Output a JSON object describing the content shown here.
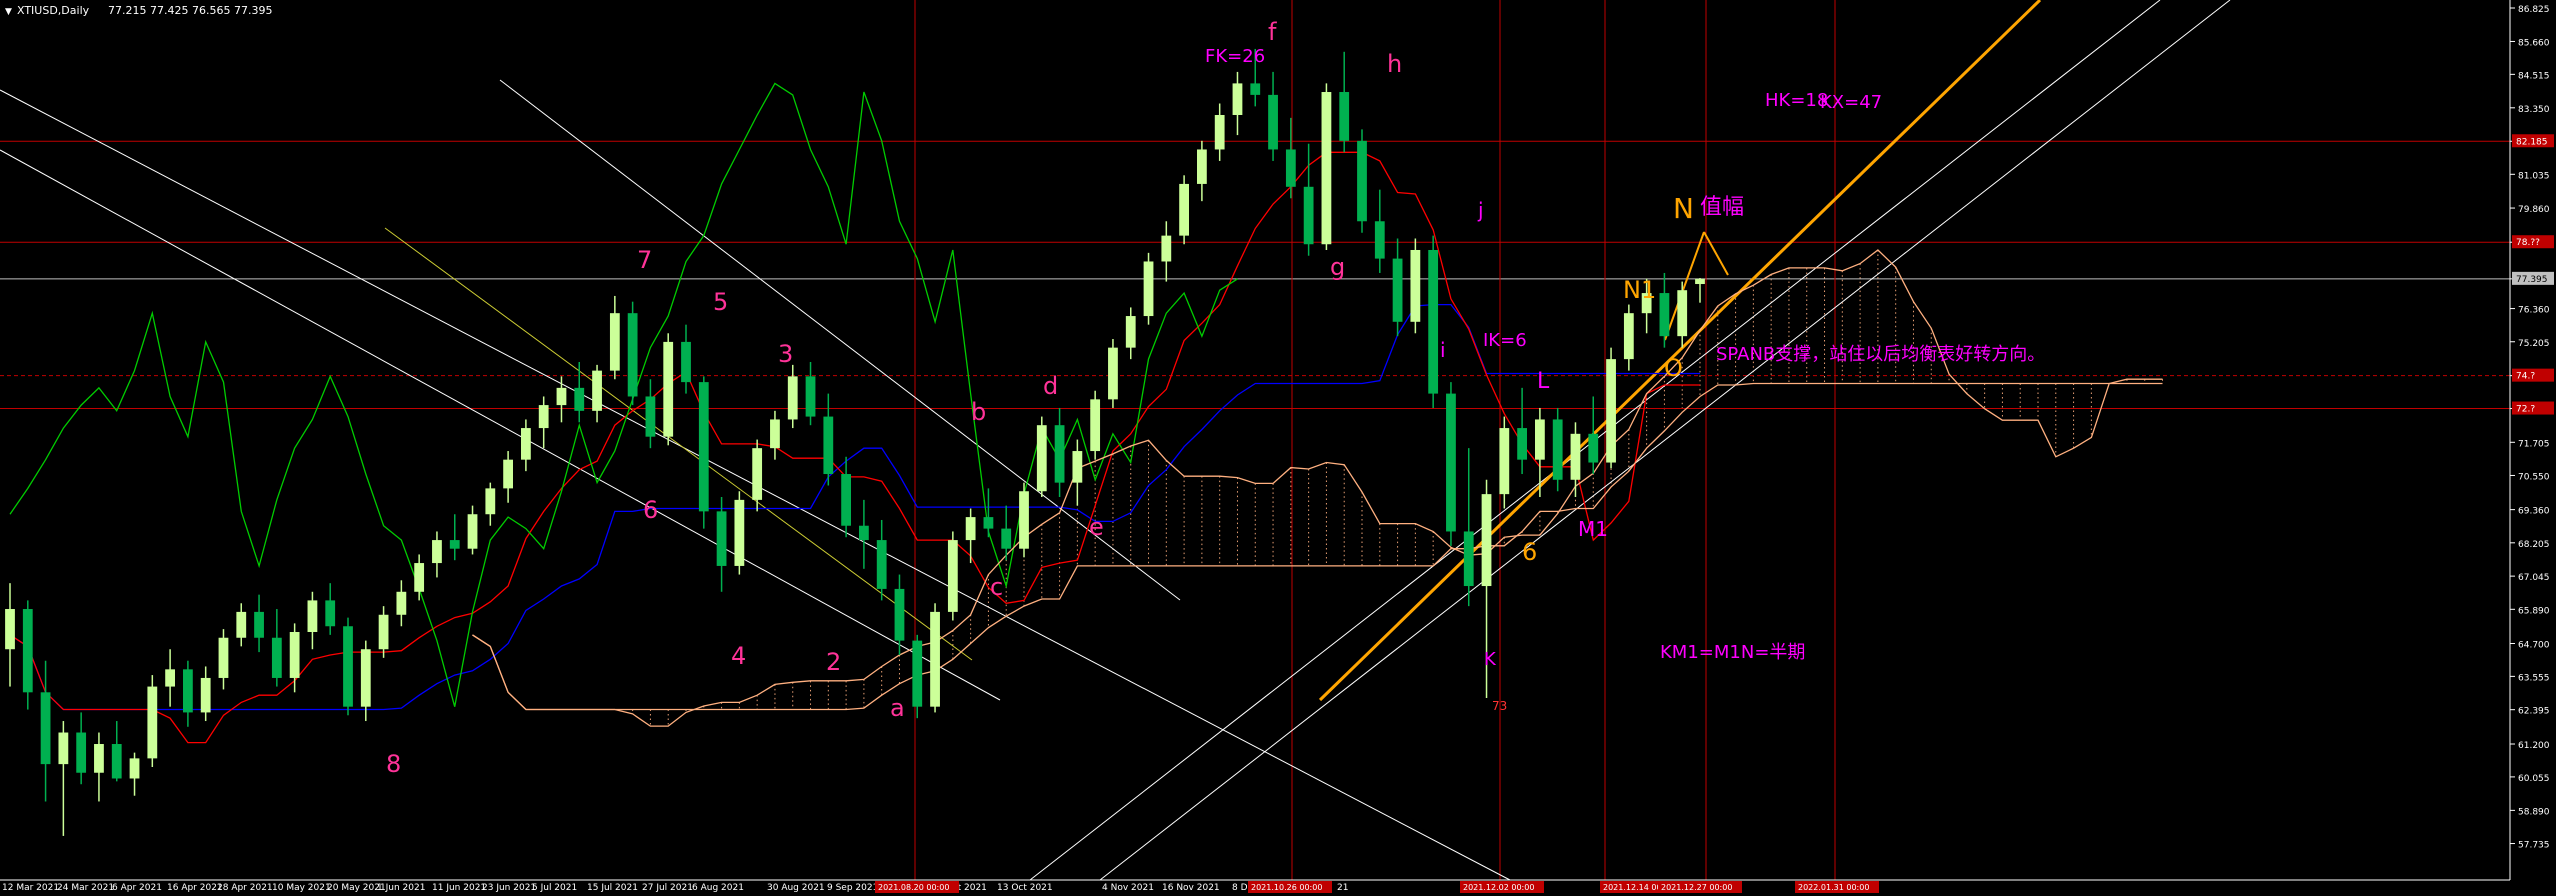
{
  "header": {
    "symbol": "XTIUSD,Daily",
    "ohlc": "77.215 77.425 76.565 77.395"
  },
  "colors": {
    "background": "#000000",
    "bull": "#ccff99",
    "bear": "#00b050",
    "tenkan": "#ff0000",
    "kijun": "#0000ff",
    "chikou": "#00cc00",
    "cloud": "#ffb080",
    "hline": "#c00000",
    "vline": "#c00000",
    "trend": "#ffffff",
    "channel": "#ffa500",
    "label_pink": "#ff3399",
    "label_magenta": "#ff00ff",
    "label_orange": "#ffa500",
    "axis_text": "#ffffff"
  },
  "y_ticks": [
    "86.825",
    "85.660",
    "84.515",
    "83.350",
    "82.185",
    "81.035",
    "79.860",
    "78.670",
    "77.395",
    "76.360",
    "75.205",
    "74.025",
    "72.880",
    "71.705",
    "70.550",
    "69.360",
    "68.205",
    "67.045",
    "65.890",
    "64.700",
    "63.555",
    "62.395",
    "61.200",
    "60.055",
    "58.890",
    "57.735",
    "56.570"
  ],
  "y_badges": {
    "h1": "82.185",
    "h2": "78.??",
    "h3": "74.?",
    "h4": "72.?",
    "last_price": "77.395"
  },
  "x_ticks": [
    "12 Mar 2021",
    "24 Mar 2021",
    "6 Apr 2021",
    "16 Apr 2021",
    "28 Apr 2021",
    "10 May 2021",
    "20 May 2021",
    "1 Jun 2021",
    "11 Jun 2021",
    "23 Jun 2021",
    "5 Jul 2021",
    "15 Jul 2021",
    "27 Jul 2021",
    "6 Aug 2021",
    "30 Aug 2021",
    "9 Sep 2021",
    "21 Sep 2021",
    "1 Oct 2021",
    "13 Oct 2021",
    "4 Nov 2021",
    "16 Nov 2021",
    "8 Dec 2021",
    "21"
  ],
  "x_badges": [
    "2021.08.20 00:00",
    "2021.10.26 00:00",
    "2021.12.02 00:00",
    "2021.12.14 00:00",
    "2021.12.27 00:00",
    "2022.01.31 00:00"
  ],
  "chart_data": {
    "type": "candlestick",
    "title": "XTIUSD,Daily",
    "ylim": [
      56.57,
      86.825
    ],
    "candles": [
      {
        "o": 64.5,
        "h": 66.8,
        "l": 63.2,
        "c": 65.9
      },
      {
        "o": 65.9,
        "h": 66.2,
        "l": 62.4,
        "c": 63.0
      },
      {
        "o": 63.0,
        "h": 64.1,
        "l": 59.2,
        "c": 60.5
      },
      {
        "o": 60.5,
        "h": 62.0,
        "l": 58.0,
        "c": 61.6
      },
      {
        "o": 61.6,
        "h": 62.3,
        "l": 59.8,
        "c": 60.2
      },
      {
        "o": 60.2,
        "h": 61.6,
        "l": 59.2,
        "c": 61.2
      },
      {
        "o": 61.2,
        "h": 62.0,
        "l": 59.9,
        "c": 60.0
      },
      {
        "o": 60.0,
        "h": 60.9,
        "l": 59.4,
        "c": 60.7
      },
      {
        "o": 60.7,
        "h": 63.6,
        "l": 60.4,
        "c": 63.2
      },
      {
        "o": 63.2,
        "h": 64.5,
        "l": 62.5,
        "c": 63.8
      },
      {
        "o": 63.8,
        "h": 64.1,
        "l": 61.8,
        "c": 62.3
      },
      {
        "o": 62.3,
        "h": 63.9,
        "l": 62.0,
        "c": 63.5
      },
      {
        "o": 63.5,
        "h": 65.2,
        "l": 63.1,
        "c": 64.9
      },
      {
        "o": 64.9,
        "h": 66.1,
        "l": 64.6,
        "c": 65.8
      },
      {
        "o": 65.8,
        "h": 66.4,
        "l": 64.4,
        "c": 64.9
      },
      {
        "o": 64.9,
        "h": 65.9,
        "l": 63.2,
        "c": 63.5
      },
      {
        "o": 63.5,
        "h": 65.4,
        "l": 63.0,
        "c": 65.1
      },
      {
        "o": 65.1,
        "h": 66.5,
        "l": 64.5,
        "c": 66.2
      },
      {
        "o": 66.2,
        "h": 66.8,
        "l": 65.0,
        "c": 65.3
      },
      {
        "o": 65.3,
        "h": 65.6,
        "l": 62.2,
        "c": 62.5
      },
      {
        "o": 62.5,
        "h": 64.8,
        "l": 62.0,
        "c": 64.5
      },
      {
        "o": 64.5,
        "h": 66.0,
        "l": 64.2,
        "c": 65.7
      },
      {
        "o": 65.7,
        "h": 66.9,
        "l": 65.3,
        "c": 66.5
      },
      {
        "o": 66.5,
        "h": 67.8,
        "l": 66.2,
        "c": 67.5
      },
      {
        "o": 67.5,
        "h": 68.6,
        "l": 67.0,
        "c": 68.3
      },
      {
        "o": 68.3,
        "h": 69.2,
        "l": 67.6,
        "c": 68.0
      },
      {
        "o": 68.0,
        "h": 69.5,
        "l": 67.8,
        "c": 69.2
      },
      {
        "o": 69.2,
        "h": 70.3,
        "l": 68.8,
        "c": 70.1
      },
      {
        "o": 70.1,
        "h": 71.4,
        "l": 69.6,
        "c": 71.1
      },
      {
        "o": 71.1,
        "h": 72.5,
        "l": 70.7,
        "c": 72.2
      },
      {
        "o": 72.2,
        "h": 73.3,
        "l": 71.5,
        "c": 73.0
      },
      {
        "o": 73.0,
        "h": 74.0,
        "l": 72.4,
        "c": 73.6
      },
      {
        "o": 73.6,
        "h": 74.5,
        "l": 72.4,
        "c": 72.8
      },
      {
        "o": 72.8,
        "h": 74.4,
        "l": 72.4,
        "c": 74.2
      },
      {
        "o": 74.2,
        "h": 76.8,
        "l": 73.9,
        "c": 76.2
      },
      {
        "o": 76.2,
        "h": 76.6,
        "l": 73.0,
        "c": 73.3
      },
      {
        "o": 73.3,
        "h": 73.9,
        "l": 71.5,
        "c": 71.9
      },
      {
        "o": 71.9,
        "h": 75.5,
        "l": 71.6,
        "c": 75.2
      },
      {
        "o": 75.2,
        "h": 75.8,
        "l": 73.4,
        "c": 73.8
      },
      {
        "o": 73.8,
        "h": 74.0,
        "l": 68.7,
        "c": 69.3
      },
      {
        "o": 69.3,
        "h": 69.8,
        "l": 66.5,
        "c": 67.4
      },
      {
        "o": 67.4,
        "h": 70.0,
        "l": 67.1,
        "c": 69.7
      },
      {
        "o": 69.7,
        "h": 71.8,
        "l": 69.3,
        "c": 71.5
      },
      {
        "o": 71.5,
        "h": 72.8,
        "l": 71.1,
        "c": 72.5
      },
      {
        "o": 72.5,
        "h": 74.4,
        "l": 72.2,
        "c": 74.0
      },
      {
        "o": 74.0,
        "h": 74.5,
        "l": 72.3,
        "c": 72.6
      },
      {
        "o": 72.6,
        "h": 73.4,
        "l": 70.2,
        "c": 70.6
      },
      {
        "o": 70.6,
        "h": 71.2,
        "l": 68.4,
        "c": 68.8
      },
      {
        "o": 68.8,
        "h": 69.7,
        "l": 67.3,
        "c": 68.3
      },
      {
        "o": 68.3,
        "h": 69.0,
        "l": 66.2,
        "c": 66.6
      },
      {
        "o": 66.6,
        "h": 67.1,
        "l": 64.3,
        "c": 64.8
      },
      {
        "o": 64.8,
        "h": 65.0,
        "l": 62.1,
        "c": 62.5
      },
      {
        "o": 62.5,
        "h": 66.1,
        "l": 62.3,
        "c": 65.8
      },
      {
        "o": 65.8,
        "h": 68.6,
        "l": 65.5,
        "c": 68.3
      },
      {
        "o": 68.3,
        "h": 69.4,
        "l": 67.5,
        "c": 69.1
      },
      {
        "o": 69.1,
        "h": 70.1,
        "l": 68.4,
        "c": 68.7
      },
      {
        "o": 68.7,
        "h": 69.5,
        "l": 67.6,
        "c": 68.0
      },
      {
        "o": 68.0,
        "h": 70.3,
        "l": 67.7,
        "c": 70.0
      },
      {
        "o": 70.0,
        "h": 72.6,
        "l": 69.8,
        "c": 72.3
      },
      {
        "o": 72.3,
        "h": 72.9,
        "l": 69.8,
        "c": 70.3
      },
      {
        "o": 70.3,
        "h": 71.8,
        "l": 69.5,
        "c": 71.4
      },
      {
        "o": 71.4,
        "h": 73.5,
        "l": 71.1,
        "c": 73.2
      },
      {
        "o": 73.2,
        "h": 75.3,
        "l": 72.9,
        "c": 75.0
      },
      {
        "o": 75.0,
        "h": 76.4,
        "l": 74.6,
        "c": 76.1
      },
      {
        "o": 76.1,
        "h": 78.3,
        "l": 75.8,
        "c": 78.0
      },
      {
        "o": 78.0,
        "h": 79.4,
        "l": 77.3,
        "c": 78.9
      },
      {
        "o": 78.9,
        "h": 81.0,
        "l": 78.6,
        "c": 80.7
      },
      {
        "o": 80.7,
        "h": 82.2,
        "l": 80.1,
        "c": 81.9
      },
      {
        "o": 81.9,
        "h": 83.5,
        "l": 81.5,
        "c": 83.1
      },
      {
        "o": 83.1,
        "h": 84.6,
        "l": 82.4,
        "c": 84.2
      },
      {
        "o": 84.2,
        "h": 85.4,
        "l": 83.4,
        "c": 83.8
      },
      {
        "o": 83.8,
        "h": 84.6,
        "l": 81.5,
        "c": 81.9
      },
      {
        "o": 81.9,
        "h": 83.0,
        "l": 80.2,
        "c": 80.6
      },
      {
        "o": 80.6,
        "h": 82.1,
        "l": 78.2,
        "c": 78.6
      },
      {
        "o": 78.6,
        "h": 84.2,
        "l": 78.4,
        "c": 83.9
      },
      {
        "o": 83.9,
        "h": 85.3,
        "l": 81.8,
        "c": 82.2
      },
      {
        "o": 82.2,
        "h": 82.6,
        "l": 79.0,
        "c": 79.4
      },
      {
        "o": 79.4,
        "h": 80.5,
        "l": 77.6,
        "c": 78.1
      },
      {
        "o": 78.1,
        "h": 78.8,
        "l": 75.4,
        "c": 75.9
      },
      {
        "o": 75.9,
        "h": 78.8,
        "l": 75.5,
        "c": 78.4
      },
      {
        "o": 78.4,
        "h": 78.9,
        "l": 72.9,
        "c": 73.4
      },
      {
        "o": 73.4,
        "h": 73.8,
        "l": 68.1,
        "c": 68.6
      },
      {
        "o": 68.6,
        "h": 71.5,
        "l": 66.0,
        "c": 66.7
      },
      {
        "o": 66.7,
        "h": 70.4,
        "l": 62.8,
        "c": 69.9
      },
      {
        "o": 69.9,
        "h": 72.6,
        "l": 69.4,
        "c": 72.2
      },
      {
        "o": 72.2,
        "h": 73.6,
        "l": 70.6,
        "c": 71.1
      },
      {
        "o": 71.1,
        "h": 72.9,
        "l": 69.8,
        "c": 72.5
      },
      {
        "o": 72.5,
        "h": 72.9,
        "l": 70.0,
        "c": 70.4
      },
      {
        "o": 70.4,
        "h": 72.4,
        "l": 69.8,
        "c": 72.0
      },
      {
        "o": 72.0,
        "h": 73.3,
        "l": 70.6,
        "c": 71.0
      },
      {
        "o": 71.0,
        "h": 75.0,
        "l": 70.8,
        "c": 74.6
      },
      {
        "o": 74.6,
        "h": 76.5,
        "l": 74.2,
        "c": 76.2
      },
      {
        "o": 76.2,
        "h": 77.4,
        "l": 75.5,
        "c": 76.9
      },
      {
        "o": 76.9,
        "h": 77.6,
        "l": 75.0,
        "c": 75.4
      },
      {
        "o": 75.4,
        "h": 77.3,
        "l": 75.0,
        "c": 77.0
      },
      {
        "o": 77.215,
        "h": 77.425,
        "l": 76.565,
        "c": 77.395
      }
    ],
    "indicators": [
      "Tenkan-sen",
      "Kijun-sen",
      "Chikou Span",
      "Senkou Span A/B cloud"
    ]
  },
  "annotations": {
    "p7": "7",
    "p5": "5",
    "p3": "3",
    "p6": "6",
    "p4": "4",
    "p2": "2",
    "pa": "a",
    "p8": "8",
    "pb": "b",
    "pc": "c",
    "pd": "d",
    "pe": "e",
    "pf": "f",
    "pg": "g",
    "ph": "h",
    "pi": "i",
    "pj": "j",
    "fk": "FK=26",
    "hk": "HK=18",
    "kx": "KX=47",
    "ik": "IK=6",
    "n_label": "N",
    "n_zhifu": "值幅",
    "n1": "N1",
    "o": "O",
    "six_orange": "6",
    "l": "L",
    "k": "K",
    "k73": "73",
    "m1": "M1",
    "spanb": "SPANB支撑，站住以后均衡表好转方向。",
    "km1": "KM1=M1N=半期"
  }
}
